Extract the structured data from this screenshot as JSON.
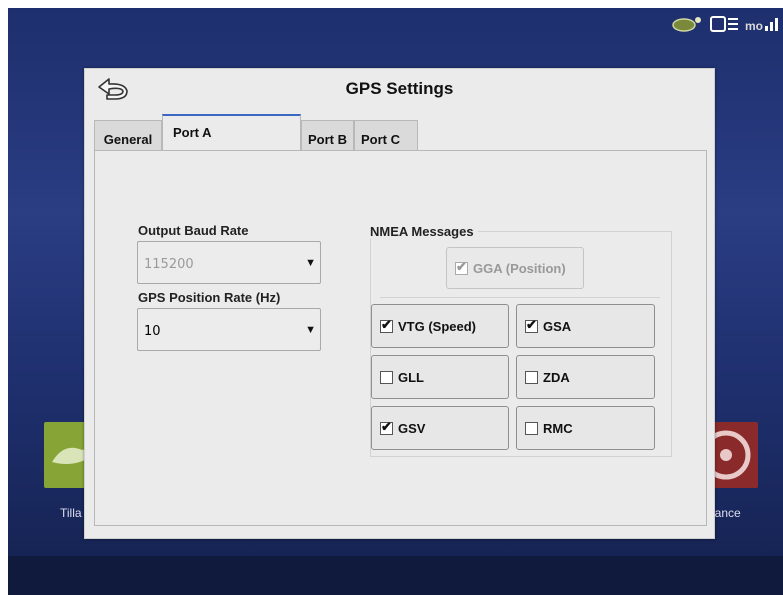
{
  "dialog": {
    "title": "GPS Settings"
  },
  "tabs": [
    "General",
    "Port A",
    "Port B",
    "Port C"
  ],
  "active_tab": "Port A",
  "output_baud_rate": {
    "label": "Output Baud Rate",
    "value": "115200"
  },
  "gps_position_rate": {
    "label": "GPS Position Rate (Hz)",
    "value": "10"
  },
  "nmea": {
    "title": "NMEA Messages",
    "gga": {
      "label": "GGA (Position)",
      "checked": true
    },
    "items": [
      {
        "label": "VTG (Speed)",
        "checked": true
      },
      {
        "label": "GSA",
        "checked": true
      },
      {
        "label": "GLL",
        "checked": false
      },
      {
        "label": "ZDA",
        "checked": false
      },
      {
        "label": "GSV",
        "checked": true
      },
      {
        "label": "RMC",
        "checked": false
      }
    ]
  },
  "background_apps": {
    "left_label": "Tilla",
    "right_label": "dance"
  },
  "check_mark": "✔",
  "dropdown_arrow": "▼",
  "icons": [
    "back-arrow-icon",
    "gps-satellite-icon",
    "display-icon",
    "modem-icon"
  ],
  "colors": {
    "tab_accent": "#3c68c4",
    "background": "#233575"
  }
}
